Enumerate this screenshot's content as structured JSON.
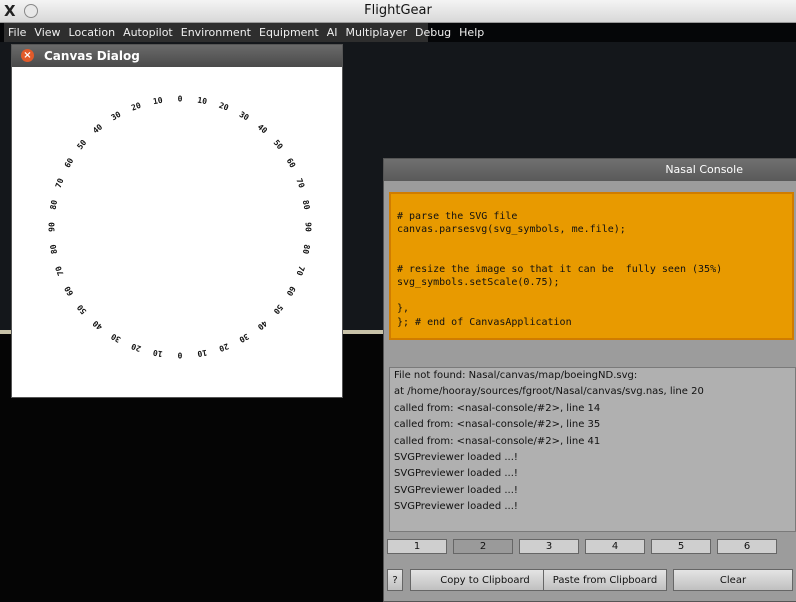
{
  "window": {
    "title": "FlightGear"
  },
  "menu": [
    "File",
    "View",
    "Location",
    "Autopilot",
    "Environment",
    "Equipment",
    "AI",
    "Multiplayer",
    "Debug",
    "Help"
  ],
  "canvas_dialog": {
    "title": "Canvas Dialog",
    "labels": [
      "0",
      "10",
      "20",
      "30",
      "40",
      "50",
      "60",
      "70",
      "80",
      "90",
      "80",
      "70",
      "60",
      "50",
      "40",
      "30",
      "20",
      "10",
      "0",
      "10",
      "20",
      "30",
      "40",
      "50",
      "60",
      "70",
      "80",
      "90",
      "80",
      "70",
      "60",
      "50",
      "40",
      "30",
      "20",
      "10"
    ]
  },
  "nasal_console": {
    "title": "Nasal Console",
    "code": "# parse the SVG file\ncanvas.parsesvg(svg_symbols, me.file);\n\n\n# resize the image so that it can be  fully seen (35%)\nsvg_symbols.setScale(0.75);\n\n},\n}; # end of CanvasApplication",
    "output": [
      "File not found: Nasal/canvas/map/boeingND.svg:",
      "  at /home/hooray/sources/fgroot/Nasal/canvas/svg.nas, line 20",
      "  called from: <nasal-console/#2>, line 14",
      "  called from: <nasal-console/#2>, line 35",
      "  called from: <nasal-console/#2>, line 41",
      "SVGPreviewer loaded ...!",
      "SVGPreviewer loaded ...!",
      "SVGPreviewer loaded ...!",
      "SVGPreviewer loaded ...!"
    ],
    "tabs": [
      "1",
      "2",
      "3",
      "4",
      "5",
      "6"
    ],
    "active_tab": "2",
    "help_label": "?",
    "copy_label": "Copy to Clipboard",
    "paste_label": "Paste from Clipboard",
    "clear_label": "Clear"
  }
}
